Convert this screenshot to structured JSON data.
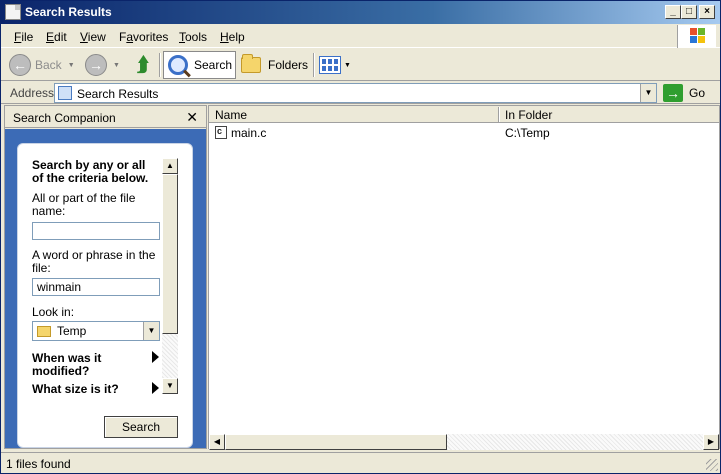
{
  "window": {
    "title": "Search Results"
  },
  "menu": {
    "items": [
      {
        "label": "File",
        "underline": "F"
      },
      {
        "label": "Edit",
        "underline": "E"
      },
      {
        "label": "View",
        "underline": "V"
      },
      {
        "label": "Favorites",
        "underline": "a"
      },
      {
        "label": "Tools",
        "underline": "T"
      },
      {
        "label": "Help",
        "underline": "H"
      }
    ]
  },
  "toolbar": {
    "back_label": "Back",
    "search_label": "Search",
    "folders_label": "Folders"
  },
  "address": {
    "label": "Address",
    "value": "Search Results",
    "go_label": "Go"
  },
  "search_companion": {
    "title": "Search Companion",
    "heading": "Search by any or all of the criteria below.",
    "filename_label": "All or part of the file name:",
    "filename_value": "",
    "phrase_label": "A word or phrase in the file:",
    "phrase_value": "winmain",
    "lookin_label": "Look in:",
    "lookin_value": "Temp",
    "when_modified": "When was it modified?",
    "size_label": "What size is it?",
    "search_button": "Search"
  },
  "results": {
    "columns": [
      "Name",
      "In Folder"
    ],
    "rows": [
      {
        "name": "main.c",
        "folder": "C:\\Temp"
      }
    ]
  },
  "status": {
    "text": "1 files found"
  },
  "colors": {
    "titlebar_start": "#0A246A",
    "titlebar_end": "#A6CAF0",
    "panel_blue": "#3c6bb6",
    "window_bg": "#ECE9D8"
  }
}
